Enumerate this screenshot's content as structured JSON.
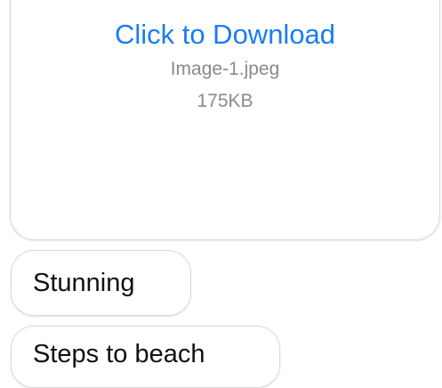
{
  "attachment": {
    "link_label": "Click to Download",
    "file_name": "Image-1.jpeg",
    "file_size": "175KB"
  },
  "messages": [
    {
      "text": "Stunning"
    },
    {
      "text": "Steps to beach"
    }
  ],
  "colors": {
    "link": "#1a7cf3",
    "secondary_text": "#8a8a8a",
    "bubble_border": "#d9d9d9"
  }
}
